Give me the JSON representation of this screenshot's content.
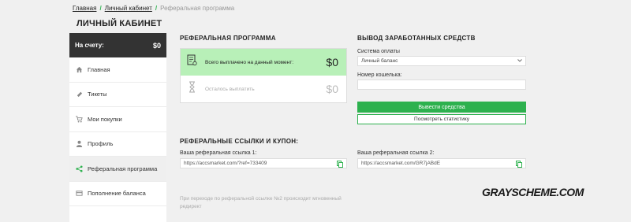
{
  "breadcrumb": {
    "home": "Главная",
    "cabinet": "Личный кабинет",
    "current": "Реферальная программа"
  },
  "page_title": "ЛИЧНЫЙ КАБИНЕТ",
  "sidebar": {
    "balance_label": "На счету:",
    "balance_value": "$0",
    "items": [
      {
        "label": "Главная",
        "icon": "home-icon"
      },
      {
        "label": "Тикеты",
        "icon": "ticket-icon"
      },
      {
        "label": "Мои покупки",
        "icon": "cart-icon"
      },
      {
        "label": "Профиль",
        "icon": "user-icon"
      },
      {
        "label": "Реферальная программа",
        "icon": "share-icon"
      },
      {
        "label": "Пополнение баланса",
        "icon": "wallet-icon"
      }
    ]
  },
  "referral": {
    "title": "РЕФЕРАЛЬНАЯ ПРОГРАММА",
    "paid_label": "Всего выплачено на данный момент:",
    "paid_value": "$0",
    "remain_label": "Осталось выплатить",
    "remain_value": "$0"
  },
  "withdraw": {
    "title": "ВЫВОД ЗАРАБОТАННЫХ СРЕДСТВ",
    "system_label": "Система оплаты",
    "system_value": "Личный баланс",
    "wallet_label": "Номер кошелька:",
    "wallet_value": "",
    "submit_label": "Вывести средства",
    "stats_label": "Посмотреть статистику"
  },
  "links": {
    "title": "РЕФЕРАЛЬНЫЕ ССЫЛКИ И КУПОН:",
    "link1_label": "Ваша реферальная ссылка 1:",
    "link1_value": "https://accsmarket.com/?ref=733409",
    "link2_label": "Ваша реферальная ссылка 2:",
    "link2_value": "https://accsmarket.com/GR7jABdE",
    "note": "При переходе по реферальной ссылке №2 происходит мгновенный редирект"
  },
  "watermark": "GRAYSCHEME.COM",
  "colors": {
    "accent": "#2db14e",
    "paid_bg": "#b8f0b8",
    "balance_bg": "#333333"
  }
}
